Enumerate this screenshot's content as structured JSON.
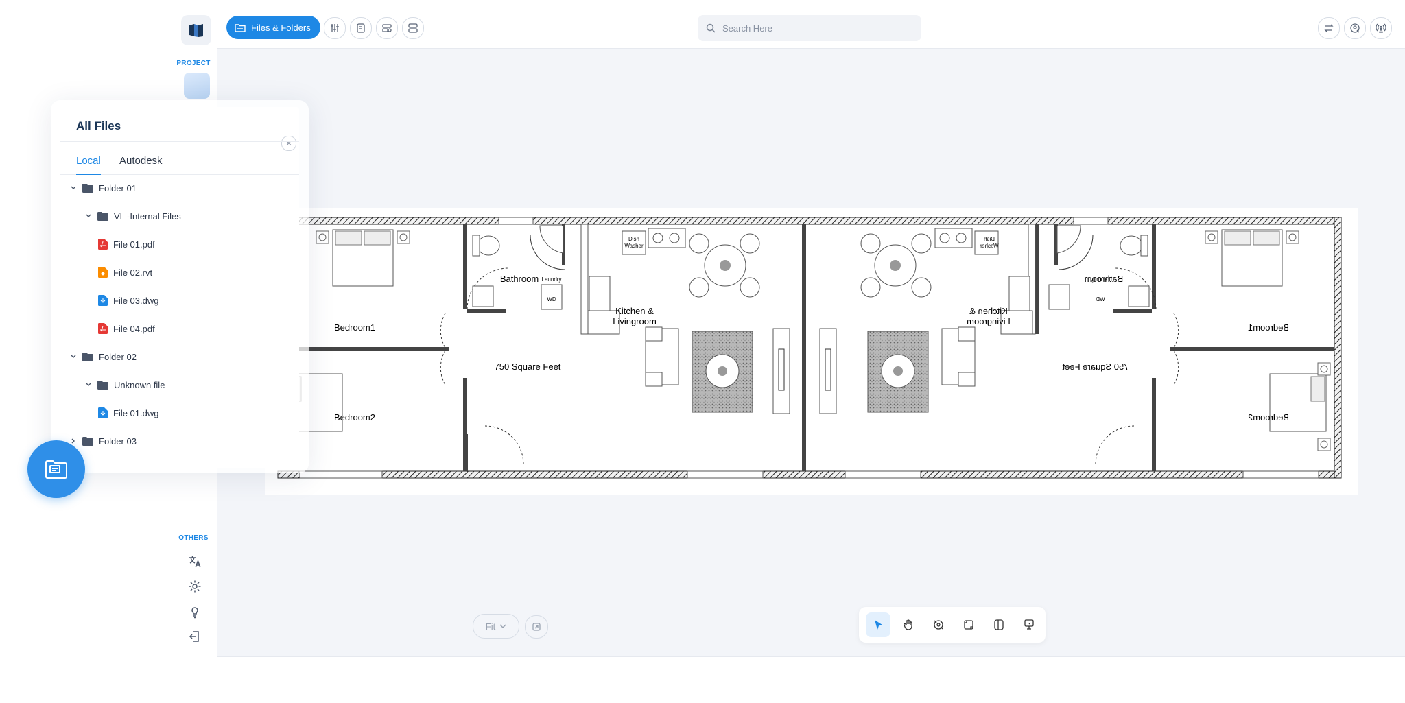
{
  "sidebar": {
    "project_label": "PROJECT",
    "others_label": "OTHERS",
    "icons": [
      "translate-icon",
      "settings-icon",
      "lightbulb-icon",
      "logout-icon"
    ]
  },
  "toolbar": {
    "files_button_label": "Files & Folders",
    "search_placeholder": "Search Here",
    "left_icons": [
      "sliders-icon",
      "document-scan-icon",
      "layout-settings-icon",
      "split-view-icon"
    ],
    "right_icons": [
      "swap-icon",
      "user-search-icon",
      "broadcast-icon"
    ]
  },
  "panel": {
    "title": "All Files",
    "tabs": [
      {
        "label": "Local",
        "active": true
      },
      {
        "label": "Autodesk",
        "active": false
      }
    ],
    "tree": [
      {
        "label": "Folder 01",
        "type": "folder",
        "expanded": true
      },
      {
        "label": "VL -Internal Files",
        "type": "folder",
        "expanded": true
      },
      {
        "label": "File 01.pdf",
        "type": "pdf"
      },
      {
        "label": "File 02.rvt",
        "type": "rvt"
      },
      {
        "label": "File 03.dwg",
        "type": "dwg"
      },
      {
        "label": "File 04.pdf",
        "type": "pdf"
      },
      {
        "label": "Folder 02",
        "type": "folder",
        "expanded": true
      },
      {
        "label": "Unknown file",
        "type": "folder",
        "expanded": true
      },
      {
        "label": "File 01.dwg",
        "type": "dwg"
      },
      {
        "label": "Folder 03",
        "type": "folder",
        "expanded": false
      }
    ]
  },
  "canvas": {
    "zoom_label": "Fit",
    "tools": [
      "select-tool",
      "pan-tool",
      "measure-tool",
      "crop-tool",
      "compare-tool",
      "annotate-tool"
    ],
    "active_tool": "select-tool",
    "floorplan_labels": {
      "bedroom1": "Bedroom1",
      "bedroom2": "Bedroom2",
      "bathroom": "Bathroom",
      "laundry": "Laundry",
      "wd": "WD",
      "dish_washer_1": "Dish",
      "dish_washer_2": "Washer",
      "kitchen_1": "Kitchen &",
      "kitchen_2": "Livingroom",
      "square_feet": "750 Square Feet"
    }
  },
  "colors": {
    "accent": "#1e88e5",
    "canvas_bg": "#f3f5f9",
    "pdf": "#e53935",
    "rvt": "#fb8c00",
    "dwg": "#1e88e5",
    "folder": "#4a5568"
  }
}
